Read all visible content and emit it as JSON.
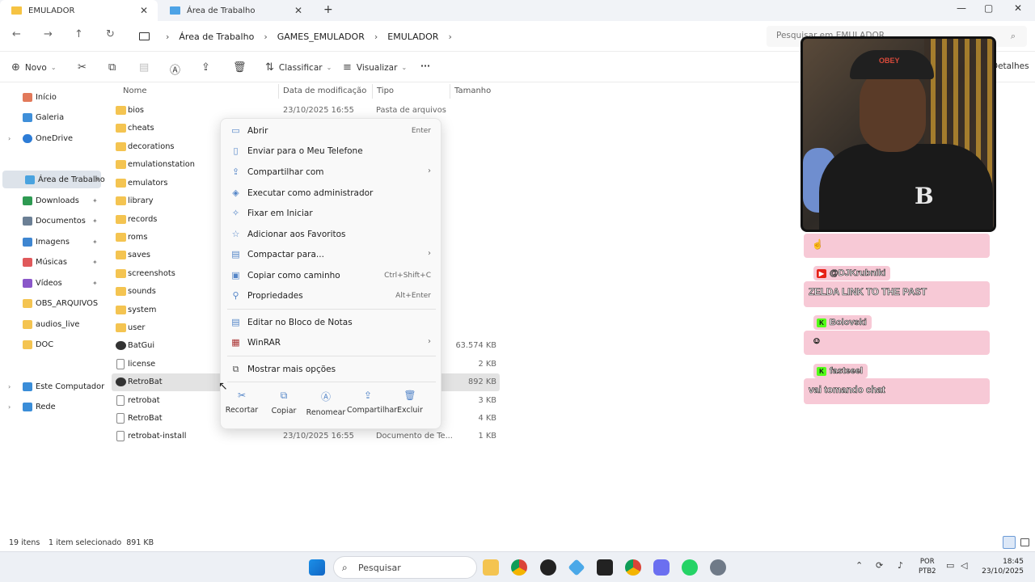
{
  "window": {
    "tabs": [
      {
        "label": "EMULADOR",
        "close": "✕"
      },
      {
        "label": "Área de Trabalho",
        "close": "✕"
      }
    ],
    "new_tab": "+",
    "controls": {
      "minimize": "—",
      "maximize": "▢",
      "close": "✕"
    }
  },
  "address": {
    "back": "←",
    "forward": "→",
    "up": "↑",
    "refresh": "↻",
    "breadcrumbs": [
      "Área de Trabalho",
      "GAMES_EMULADOR",
      "EMULADOR"
    ],
    "sep": "›",
    "search_placeholder": "Pesquisar em EMULADOR"
  },
  "toolbar": {
    "new": "Novo",
    "sort": "Classificar",
    "view": "Visualizar",
    "more": "···",
    "details": "Detalhes"
  },
  "sidebar": {
    "items": [
      {
        "label": "Início",
        "color": "#e2795a"
      },
      {
        "label": "Galeria",
        "color": "#3f8fd9"
      },
      {
        "label": "OneDrive",
        "color": "#2d7cd6",
        "expandable": true
      },
      {
        "label": "Área de Trabalho",
        "color": "#4aa3df",
        "pinned": true,
        "selected": true
      },
      {
        "label": "Downloads",
        "color": "#2e9a52",
        "pinned": true
      },
      {
        "label": "Documentos",
        "color": "#6b7f95",
        "pinned": true
      },
      {
        "label": "Imagens",
        "color": "#3e86d1",
        "pinned": true
      },
      {
        "label": "Músicas",
        "color": "#e0595b",
        "pinned": true
      },
      {
        "label": "Vídeos",
        "color": "#8a57c9",
        "pinned": true
      },
      {
        "label": "OBS_ARQUIVOS",
        "color": "#f4c451"
      },
      {
        "label": "audios_live",
        "color": "#f4c451"
      },
      {
        "label": "DOC",
        "color": "#f4c451"
      },
      {
        "label": "Este Computador",
        "color": "#3a8dd8",
        "expandable": true
      },
      {
        "label": "Rede",
        "color": "#3a8dd8",
        "expandable": true
      }
    ],
    "pin_glyph": "📌",
    "chevron": "›"
  },
  "columns": {
    "name": "Nome",
    "date": "Data de modificação",
    "type": "Tipo",
    "size": "Tamanho"
  },
  "files": [
    {
      "name": "bios",
      "date": "23/10/2025 16:55",
      "type": "Pasta de arquivos",
      "size": "",
      "kind": "folder"
    },
    {
      "name": "cheats",
      "date": "",
      "type": "",
      "size": "",
      "kind": "folder"
    },
    {
      "name": "decorations",
      "date": "",
      "type": "",
      "size": "",
      "kind": "folder"
    },
    {
      "name": "emulationstation",
      "date": "",
      "type": "",
      "size": "",
      "kind": "folder"
    },
    {
      "name": "emulators",
      "date": "",
      "type": "",
      "size": "",
      "kind": "folder"
    },
    {
      "name": "library",
      "date": "",
      "type": "",
      "size": "",
      "kind": "folder"
    },
    {
      "name": "records",
      "date": "",
      "type": "",
      "size": "",
      "kind": "folder"
    },
    {
      "name": "roms",
      "date": "",
      "type": "",
      "size": "",
      "kind": "folder"
    },
    {
      "name": "saves",
      "date": "",
      "type": "",
      "size": "",
      "kind": "folder"
    },
    {
      "name": "screenshots",
      "date": "",
      "type": "",
      "size": "",
      "kind": "folder"
    },
    {
      "name": "sounds",
      "date": "",
      "type": "",
      "size": "",
      "kind": "folder"
    },
    {
      "name": "system",
      "date": "",
      "type": "",
      "size": "",
      "kind": "folder"
    },
    {
      "name": "user",
      "date": "",
      "type": "",
      "size": "",
      "kind": "folder"
    },
    {
      "name": "BatGui",
      "date": "",
      "type": "",
      "size": "63.574 KB",
      "kind": "app"
    },
    {
      "name": "license",
      "date": "",
      "type": "",
      "size": "2 KB",
      "kind": "file"
    },
    {
      "name": "RetroBat",
      "date": "",
      "type": "",
      "size": "892 KB",
      "kind": "app",
      "selected": true
    },
    {
      "name": "retrobat",
      "date": "",
      "type": "",
      "size": "3 KB",
      "kind": "file"
    },
    {
      "name": "RetroBat",
      "date": "",
      "type": "",
      "size": "4 KB",
      "kind": "file"
    },
    {
      "name": "retrobat-install",
      "date": "23/10/2025 16:55",
      "type": "Documento de Te...",
      "size": "1 KB",
      "kind": "file"
    }
  ],
  "context_menu": {
    "items": [
      {
        "label": "Abrir",
        "shortcut": "Enter",
        "icon": "▭",
        "arrow": ""
      },
      {
        "label": "Enviar para o Meu Telefone",
        "shortcut": "",
        "icon": "▯",
        "arrow": ""
      },
      {
        "label": "Compartilhar com",
        "shortcut": "",
        "icon": "⇪",
        "arrow": "›"
      },
      {
        "label": "Executar como administrador",
        "shortcut": "",
        "icon": "◈",
        "arrow": ""
      },
      {
        "label": "Fixar em Iniciar",
        "shortcut": "",
        "icon": "✧",
        "arrow": ""
      },
      {
        "label": "Adicionar aos Favoritos",
        "shortcut": "",
        "icon": "☆",
        "arrow": ""
      },
      {
        "label": "Compactar para...",
        "shortcut": "",
        "icon": "▤",
        "arrow": "›"
      },
      {
        "label": "Copiar como caminho",
        "shortcut": "Ctrl+Shift+C",
        "icon": "▣",
        "arrow": ""
      },
      {
        "label": "Propriedades",
        "shortcut": "Alt+Enter",
        "icon": "⚲",
        "arrow": ""
      },
      {
        "label": "Editar no Bloco de Notas",
        "shortcut": "",
        "icon": "▤",
        "arrow": ""
      },
      {
        "label": "WinRAR",
        "shortcut": "",
        "icon": "▦",
        "arrow": "›"
      },
      {
        "label": "Mostrar mais opções",
        "shortcut": "",
        "icon": "⧉",
        "arrow": ""
      }
    ],
    "quick_actions": [
      {
        "label": "Recortar",
        "icon": "✂"
      },
      {
        "label": "Copiar",
        "icon": "⧉"
      },
      {
        "label": "Renomear",
        "icon": "Ⓐ"
      },
      {
        "label": "Compartilhar",
        "icon": "⇪"
      },
      {
        "label": "Excluir",
        "icon": "🗑"
      }
    ]
  },
  "status": {
    "count": "19 itens",
    "selection": "1 item selecionado  891 KB"
  },
  "taskbar": {
    "search": "Pesquisar",
    "lang_top": "POR",
    "lang_bottom": "PTB2",
    "time": "18:45",
    "date": "23/10/2025"
  },
  "webcam": {
    "cap_brand": "OBEY",
    "shirt_logo": "B"
  },
  "chat": [
    {
      "user": "",
      "message": "☝",
      "platform": ""
    },
    {
      "user": "@DJKrubniki",
      "message": "ZELDA LINK TO THE PAST",
      "platform": "youtube"
    },
    {
      "user": "Bolovski",
      "message": "☺",
      "platform": "kick"
    },
    {
      "user": "fasteeel",
      "message": "vai tomando chat",
      "platform": "kick"
    }
  ]
}
